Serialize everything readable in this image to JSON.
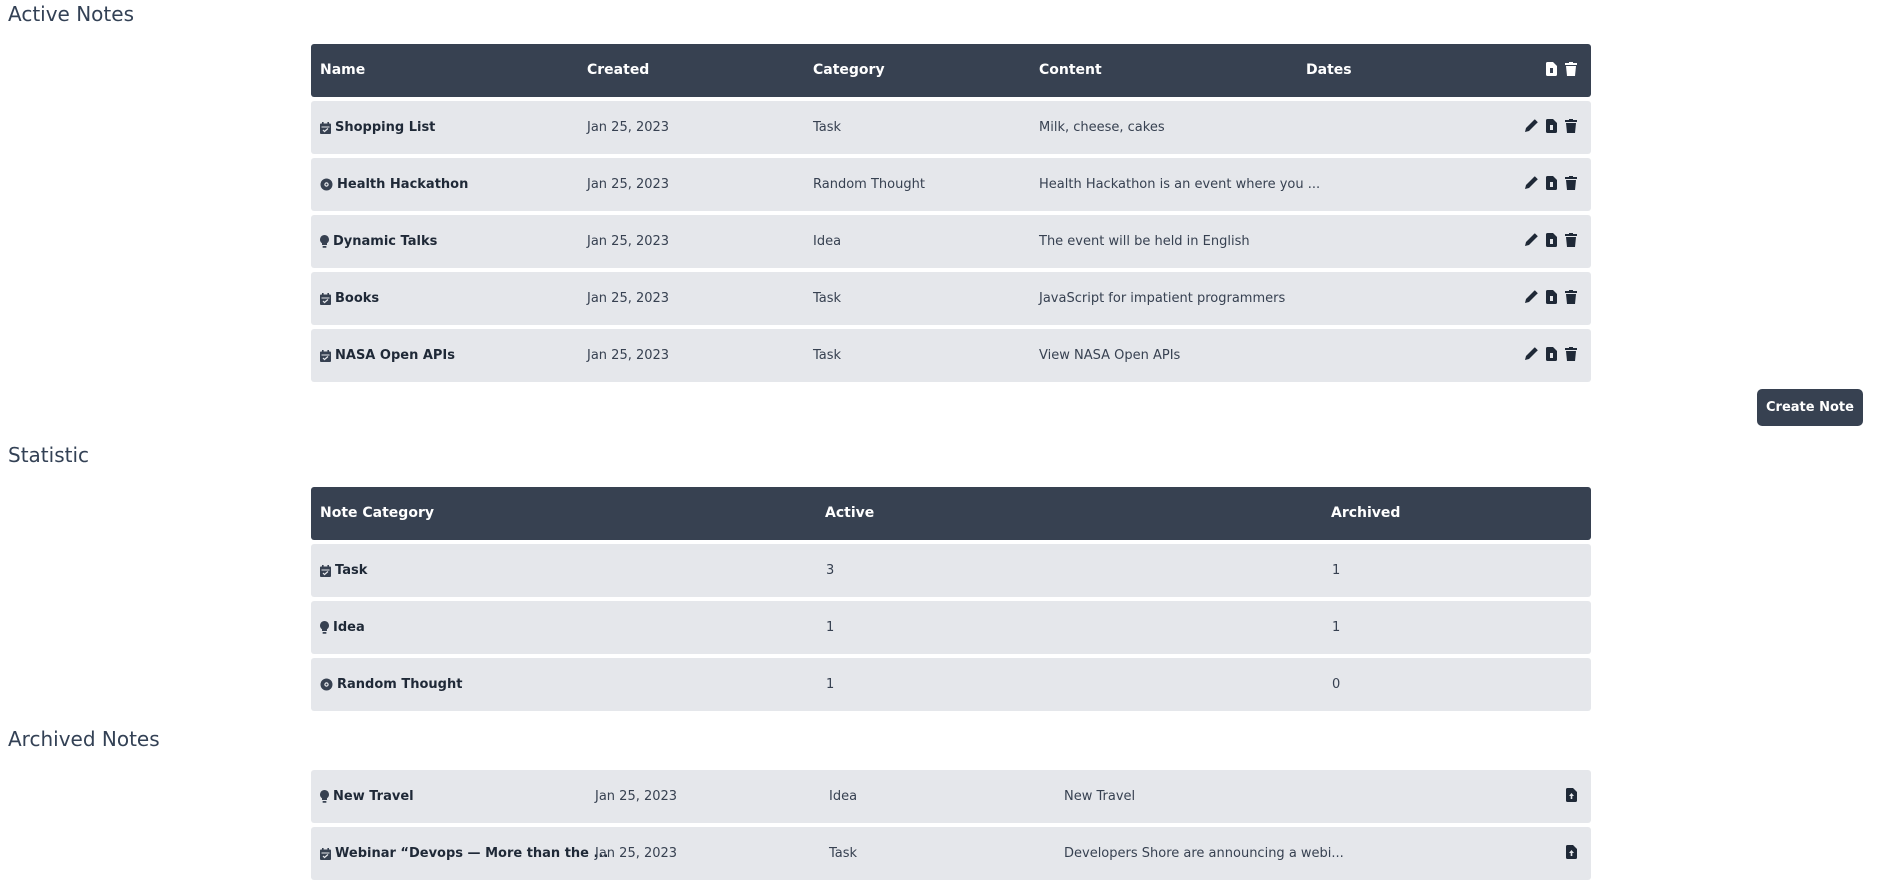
{
  "active": {
    "title": "Active Notes",
    "headers": {
      "name": "Name",
      "created": "Created",
      "category": "Category",
      "content": "Content",
      "dates": "Dates"
    },
    "header_icons": [
      "archive-icon",
      "trash-icon"
    ],
    "rows": [
      {
        "icon": "calendar-icon",
        "name": "Shopping List",
        "created": "Jan 25, 2023",
        "category": "Task",
        "content": "Milk, cheese, cakes",
        "dates": ""
      },
      {
        "icon": "brain-icon",
        "name": "Health Hackathon",
        "created": "Jan 25, 2023",
        "category": "Random Thought",
        "content": "Health Hackathon is an event where you ...",
        "dates": ""
      },
      {
        "icon": "lightbulb-icon",
        "name": "Dynamic Talks",
        "created": "Jan 25, 2023",
        "category": "Idea",
        "content": "The event will be held in English",
        "dates": ""
      },
      {
        "icon": "calendar-icon",
        "name": "Books",
        "created": "Jan 25, 2023",
        "category": "Task",
        "content": "JavaScript for impatient programmers",
        "dates": ""
      },
      {
        "icon": "calendar-icon",
        "name": "NASA Open APIs",
        "created": "Jan 25, 2023",
        "category": "Task",
        "content": "View NASA Open APIs",
        "dates": ""
      }
    ],
    "row_icons": [
      "pencil-icon",
      "archive-icon",
      "trash-icon"
    ]
  },
  "create_button": "Create Note",
  "statistic": {
    "title": "Statistic",
    "headers": {
      "category": "Note Category",
      "active": "Active",
      "archived": "Archived"
    },
    "rows": [
      {
        "icon": "calendar-icon",
        "category": "Task",
        "active": "3",
        "archived": "1"
      },
      {
        "icon": "lightbulb-icon",
        "category": "Idea",
        "active": "1",
        "archived": "1"
      },
      {
        "icon": "brain-icon",
        "category": "Random Thought",
        "active": "1",
        "archived": "0"
      }
    ]
  },
  "archived": {
    "title": "Archived Notes",
    "rows": [
      {
        "icon": "lightbulb-icon",
        "name": "New Travel",
        "created": "Jan 25, 2023",
        "category": "Idea",
        "content": "New Travel"
      },
      {
        "icon": "calendar-icon",
        "name": "Webinar “Devops — More than the ...",
        "created": "Jan 25, 2023",
        "category": "Task",
        "content": "Developers Shore are announcing a webi..."
      }
    ],
    "row_icons": [
      "unarchive-icon"
    ]
  },
  "colors": {
    "header_bg": "#374151",
    "row_bg": "#e5e7eb",
    "button_bg": "#374151"
  }
}
